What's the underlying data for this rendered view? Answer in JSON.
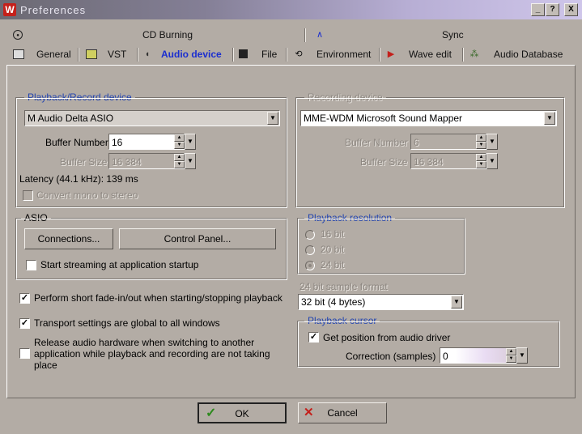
{
  "window": {
    "title": "Preferences",
    "logo": "W",
    "buttons": {
      "help": "?",
      "close": "X",
      "minimize": "_"
    }
  },
  "tabs_row1": [
    {
      "label": "CD Burning",
      "icon": "cd-icon"
    },
    {
      "label": "Sync",
      "icon": "sync-icon"
    }
  ],
  "tabs_row2": [
    {
      "label": "General",
      "icon": "general-icon"
    },
    {
      "label": "VST",
      "icon": "vst-icon"
    },
    {
      "label": "Audio device",
      "icon": "speaker-icon",
      "active": true
    },
    {
      "label": "File",
      "icon": "floppy-icon"
    },
    {
      "label": "Environment",
      "icon": "environment-icon"
    },
    {
      "label": "Wave edit",
      "icon": "wave-edit-icon"
    },
    {
      "label": "Audio Database",
      "icon": "database-icon"
    }
  ],
  "playback": {
    "title": "Playback/Record device",
    "device": "M Audio Delta ASIO",
    "buffer_number_label": "Buffer Number",
    "buffer_number": "16",
    "buffer_size_label": "Buffer Size",
    "buffer_size": "16 384",
    "latency": "Latency (44.1 kHz): 139 ms",
    "convert_mono": "Convert mono to stereo"
  },
  "recording": {
    "title": "Recording device",
    "device": "MME-WDM Microsoft Sound Mapper",
    "buffer_number_label": "Buffer Number",
    "buffer_number": "6",
    "buffer_size_label": "Buffer Size",
    "buffer_size": "16 384"
  },
  "asio": {
    "title": "ASIO",
    "connections": "Connections...",
    "control_panel": "Control Panel...",
    "start_streaming": "Start streaming at application startup"
  },
  "resolution": {
    "title": "Playback resolution",
    "options": [
      "16 bit",
      "20 bit",
      "24 bit"
    ]
  },
  "sample_format": {
    "label": "24 bit sample format",
    "value": "32 bit (4 bytes)"
  },
  "checks": {
    "fade": "Perform short fade-in/out when starting/stopping playback",
    "transport": "Transport settings are global to all windows",
    "release_line1": "Release audio hardware when switching to another",
    "release_line2": "application while playback and recording are not taking",
    "release_line3": "place"
  },
  "cursor": {
    "title": "Playback cursor",
    "get_position": "Get position from audio driver",
    "correction_label": "Correction (samples)",
    "correction": "0"
  },
  "footer": {
    "ok": "OK",
    "cancel": "Cancel"
  }
}
